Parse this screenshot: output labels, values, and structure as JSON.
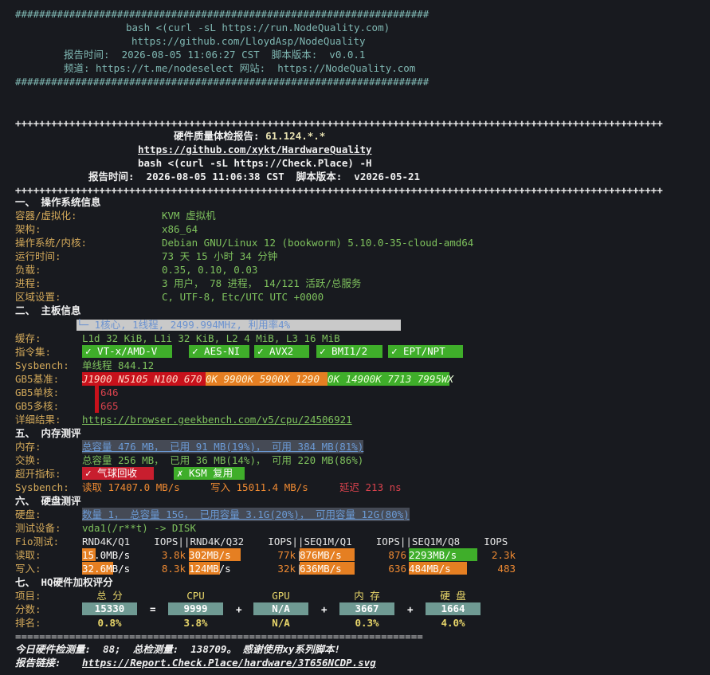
{
  "banner": {
    "border": "#####################################################################",
    "line1": "bash <(curl -sL https://run.NodeQuality.com)",
    "line2": "https://github.com/LloydAsp/NodeQuality",
    "line3": "报告时间:  2026-08-05 11:06:27 CST  脚本版本:  v0.0.1",
    "line4": "频道: https://t.me/nodeselect 网站:  https://NodeQuality.com"
  },
  "hw_header": {
    "border": "++++++++++++++++++++++++++++++++++++++++++++++++++++++++++++++++++++++++++++++++++++++++++++++++++++++++++++++++++",
    "title": "硬件质量体检报告: ",
    "ip": "61.124.*.*",
    "repo": "https://github.com/xykt/HardwareQuality",
    "cmd": "bash <(curl -sL https://Check.Place) -H",
    "report_time": "报告时间:  2026-08-05 11:06:38 CST  脚本版本:  v2026-05-21"
  },
  "os": {
    "section": "一、 操作系统信息",
    "rows": [
      {
        "label": "容器/虚拟化:",
        "value": "KVM 虚拟机"
      },
      {
        "label": "架构:",
        "value": "x86_64"
      },
      {
        "label": "操作系统/内核:",
        "value": "Debian GNU/Linux 12 (bookworm) 5.10.0-35-cloud-amd64"
      },
      {
        "label": "运行时间:",
        "value": "73 天 15 小时 34 分钟"
      },
      {
        "label": "负载:",
        "value": "0.35, 0.10, 0.03"
      },
      {
        "label": "进程:",
        "value": "3 用户， 78 进程， 14/121 活跃/总服务"
      },
      {
        "label": "区域设置:",
        "value": "C, UTF-8, Etc/UTC UTC +0000"
      }
    ]
  },
  "board": {
    "section": "二、 主板信息",
    "cpu_bar": "└─ 1核心, 1线程, 2499.994MHz, 利用率4%",
    "cache_label": "缓存:",
    "cache_value": "L1d 32 KiB, L1i 32 KiB, L2 4 MiB, L3 16 MiB",
    "isa_label": "指令集:",
    "isa_tags": [
      "✓ VT-x/AMD-V",
      "✓ AES-NI",
      "✓ AVX2",
      "✓ BMI1/2",
      "✓ EPT/NPT"
    ],
    "sysbench_label": "Sysbench:",
    "sysbench_value": "单线程 844.12",
    "gb5_base_label": "GB5基准:",
    "gb5_scale": [
      "J1900 N5105 N100 670",
      "0K 9900K 5900X 1290",
      "0K 14900K 7713 7995WX"
    ],
    "gb5_single_label": "GB5单核:",
    "gb5_single": "646",
    "gb5_multi_label": "GB5多核:",
    "gb5_multi": "665",
    "detail_label": "详细结果:",
    "detail_url": "https://browser.geekbench.com/v5/cpu/24506921"
  },
  "mem": {
    "section": "五、 内存测评",
    "mem_label": "内存:",
    "mem_value": "总容量 476 MB， 已用 91 MB(19%)， 可用 384 MB(81%)",
    "swap_label": "交换:",
    "swap_value": "总容量 256 MB， 已用 36 MB(14%)， 可用 220 MB(86%)",
    "over_label": "超开指标:",
    "over_tags": [
      {
        "text": "✓ 气球回收",
        "color": "#c81e2e"
      },
      {
        "text": "✗ KSM 复用",
        "color": "#3fae2a"
      }
    ],
    "sb_label": "Sysbench:",
    "sb_read": "读取 17407.0 MB/s",
    "sb_write": "写入 15011.4 MB/s",
    "sb_latency": "延迟 213 ns"
  },
  "disk": {
    "section": "六、 硬盘测评",
    "disk_label": "硬盘:",
    "disk_value": "数量 1， 总容量 15G， 已用容量 3.1G(20%)， 可用容量 12G(80%)",
    "dev_label": "测试设备:",
    "dev_value": "vda1(/r**t) -> DISK",
    "fio_label": "Fio测试:",
    "fio_header": "RND4K/Q1    IOPS||RND4K/Q32    IOPS||SEQ1M/Q1    IOPS||SEQ1M/Q8    IOPS",
    "read_label": "读取:",
    "write_label": "写入:",
    "read": [
      {
        "bw": "15.0MB/s",
        "iops": "3.8k",
        "fill": 0.2,
        "color": "#e57f22"
      },
      {
        "bw": "302MB/s",
        "iops": "77k",
        "fill": 0.75,
        "color": "#e57f22"
      },
      {
        "bw": "876MB/s",
        "iops": "876",
        "fill": 0.8,
        "color": "#e57f22"
      },
      {
        "bw": "2293MB/s",
        "iops": "2.3k",
        "fill": 1.0,
        "color": "#3fae2a"
      }
    ],
    "write": [
      {
        "bw": "32.6MB/s",
        "iops": "8.3k",
        "fill": 0.45,
        "color": "#e57f22"
      },
      {
        "bw": "124MB/s",
        "iops": "32k",
        "fill": 0.45,
        "color": "#e57f22"
      },
      {
        "bw": "636MB/s",
        "iops": "636",
        "fill": 0.8,
        "color": "#e57f22"
      },
      {
        "bw": "484MB/s",
        "iops": "483",
        "fill": 0.85,
        "color": "#e57f22"
      }
    ]
  },
  "score": {
    "section": "七、 HQ硬件加权评分",
    "item_label": "项目:",
    "score_label": "分数:",
    "rank_label": "排名:",
    "cols": [
      "总 分",
      "CPU",
      "GPU",
      "内 存",
      "硬 盘"
    ],
    "values": [
      "15330",
      "9999",
      "N/A",
      "3667",
      "1664"
    ],
    "ops": [
      "=",
      "+",
      "+",
      "+"
    ],
    "ranks": [
      "0.8%",
      "3.8%",
      "N/A",
      "0.3%",
      "4.0%"
    ]
  },
  "footer": {
    "border": "====================================================================",
    "line1": "今日硬件检测量:  88;  总检测量:  138709。 感谢使用xy系列脚本!",
    "link_label": "报告链接:",
    "link_url": "https://Report.Check.Place/hardware/3T656NCDP.svg"
  }
}
